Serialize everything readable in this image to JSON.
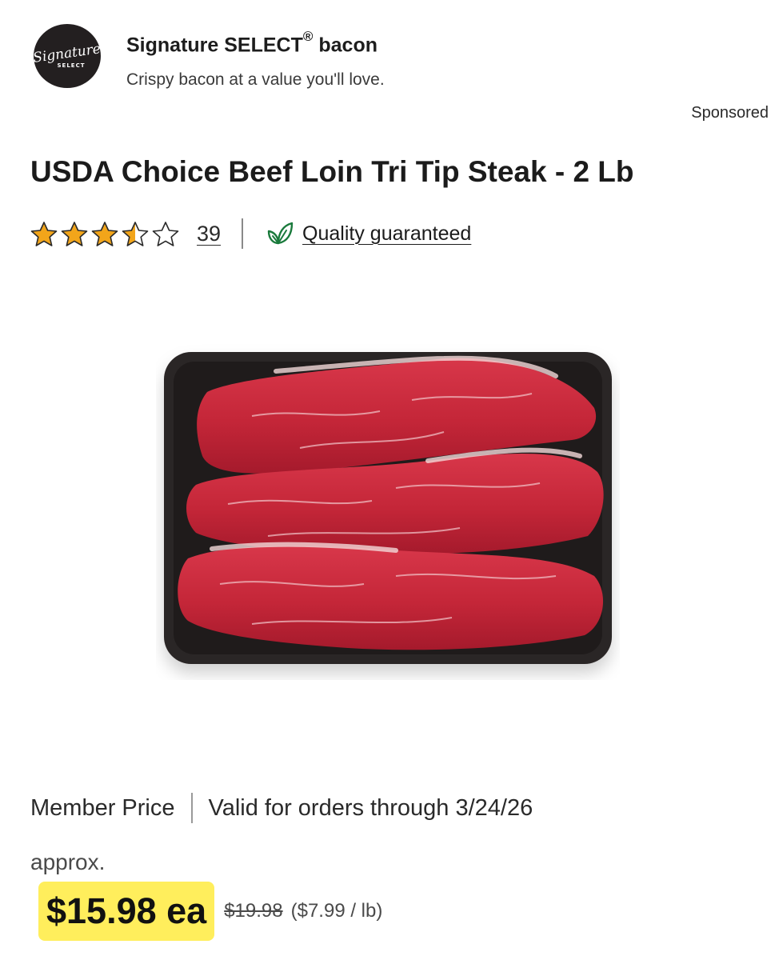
{
  "ad": {
    "logo_text_top": "Signature",
    "logo_text_bottom": "SELECT",
    "brand": "Signature SELECT",
    "registered": "®",
    "product": "bacon",
    "tagline": "Crispy bacon at a value you'll love.",
    "sponsored_label": "Sponsored"
  },
  "product": {
    "title": "USDA Choice Beef Loin Tri Tip Steak - 2 Lb",
    "rating": 3.5,
    "rating_max": 5,
    "review_count": "39",
    "quality_label": "Quality guaranteed",
    "quality_icon": "leaf-icon",
    "image_icon": "tri-tip-steak-tray-image"
  },
  "pricing": {
    "member_label": "Member Price",
    "validity": "Valid for orders through 3/24/26",
    "approx_label": "approx.",
    "sale_price": "$15.98 ea",
    "regular_price": "$19.98",
    "unit_price": "($7.99 / lb)"
  },
  "colors": {
    "star": "#f2a51a",
    "price_highlight": "#ffee5c",
    "leaf": "#1a7a3c",
    "text": "#1d1d1d"
  }
}
